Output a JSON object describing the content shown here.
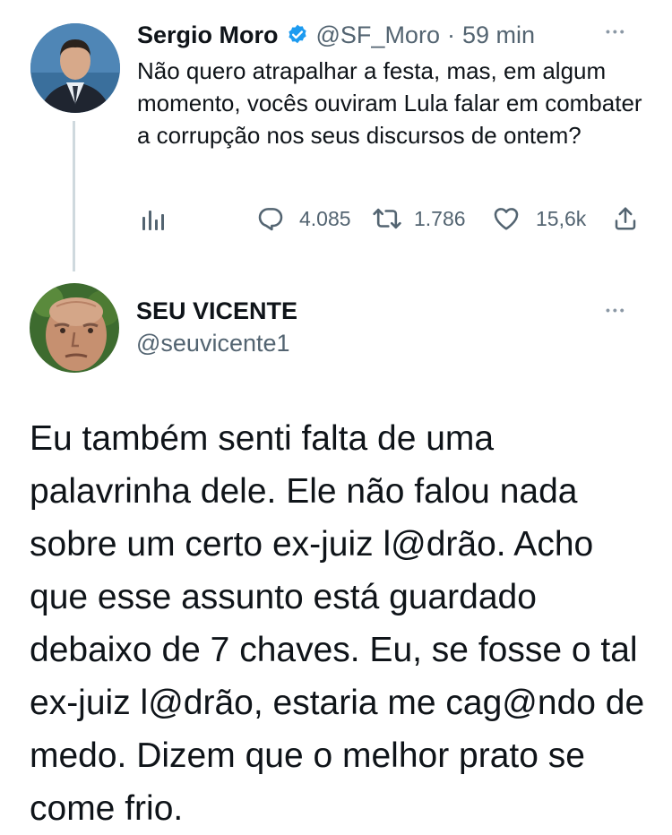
{
  "tweet1": {
    "name": "Sergio Moro",
    "handle": "@SF_Moro",
    "separator": "·",
    "time": "59 min",
    "text": "Não quero atrapalhar a festa, mas, em algum momento, vocês ouviram Lula falar em combater a corrupção nos seus discursos de ontem?",
    "replies": "4.085",
    "retweets": "1.786",
    "likes": "15,6k",
    "verified_color": "#1d9bf0",
    "more": "•••"
  },
  "tweet2": {
    "name": "SEU VICENTE",
    "handle": "@seuvicente1",
    "more": "•••",
    "text": "Eu também senti falta de uma palavrinha dele. Ele não falou nada sobre um certo ex-juiz l@drão. Acho que esse assunto está guardado debaixo de 7 chaves. Eu, se fosse o tal ex-juiz l@drão, estaria me cag@ndo de medo. Dizem que o melhor prato se come frio."
  }
}
